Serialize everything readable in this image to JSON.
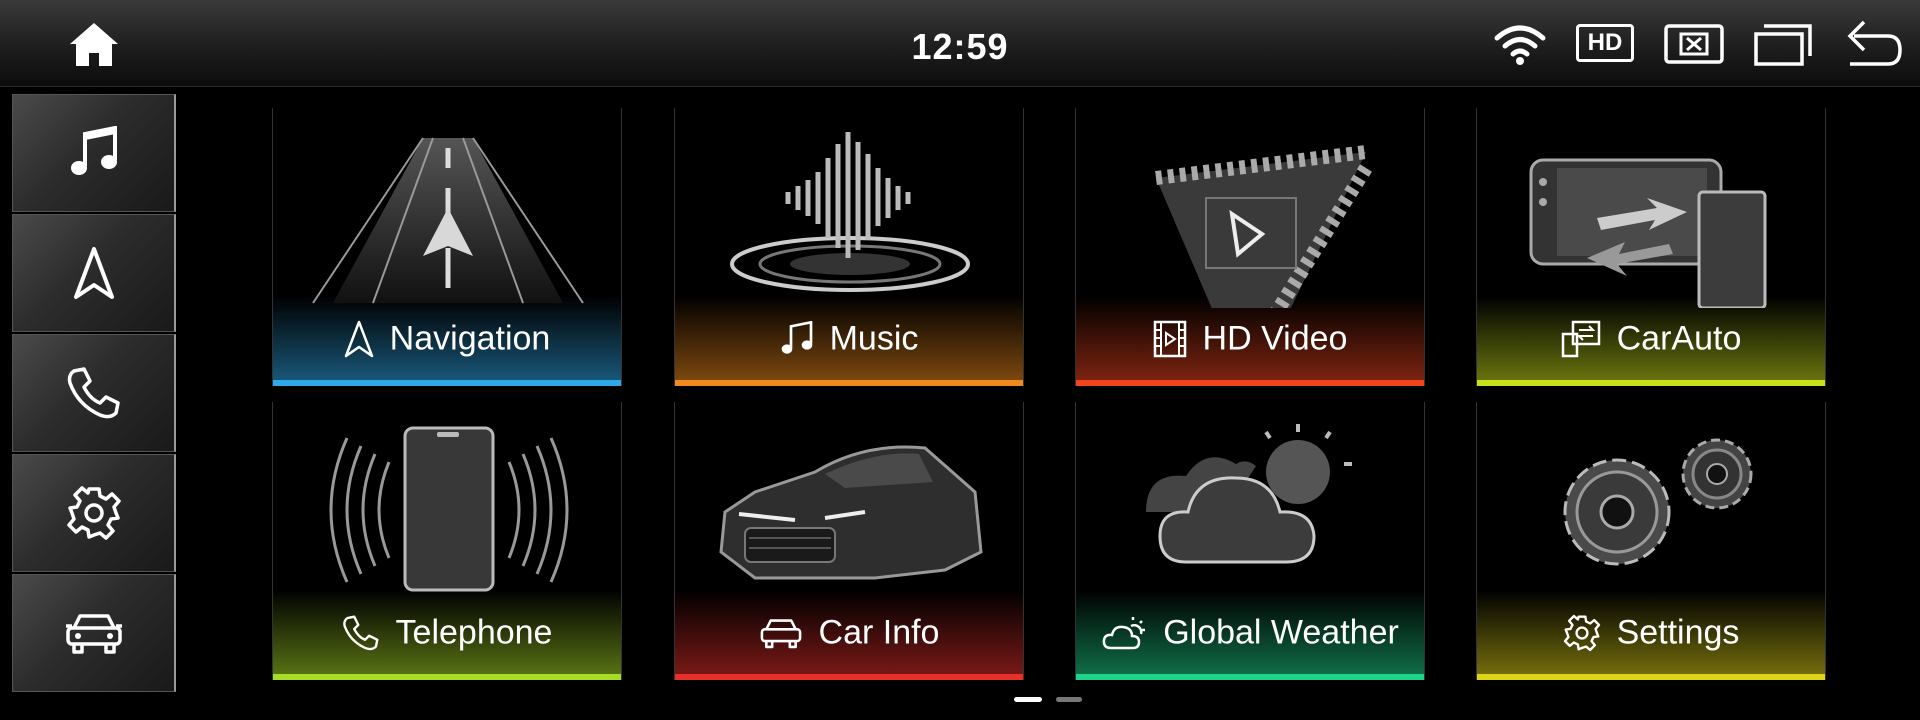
{
  "status_bar": {
    "time": "12:59",
    "hd_label": "HD",
    "icons": [
      "home-icon",
      "wifi-icon",
      "hd-icon",
      "close-app-icon",
      "recent-apps-icon",
      "back-icon"
    ]
  },
  "sidebar": {
    "items": [
      {
        "icon": "music-note-icon"
      },
      {
        "icon": "navigation-arrow-icon"
      },
      {
        "icon": "phone-icon"
      },
      {
        "icon": "gear-icon"
      },
      {
        "icon": "car-icon"
      }
    ]
  },
  "apps": [
    {
      "label": "Navigation",
      "icon": "navigation-arrow-icon",
      "accent": "#2fa8e8"
    },
    {
      "label": "Music",
      "icon": "music-note-icon",
      "accent": "#f08a1c"
    },
    {
      "label": "HD Video",
      "icon": "film-icon",
      "accent": "#f0441e"
    },
    {
      "label": "CarAuto",
      "icon": "phone-link-icon",
      "accent": "#c8e01a"
    },
    {
      "label": "Telephone",
      "icon": "phone-icon",
      "accent": "#a8dc26"
    },
    {
      "label": "Car Info",
      "icon": "car-icon",
      "accent": "#e8302a"
    },
    {
      "label": "Global Weather",
      "icon": "cloud-sun-icon",
      "accent": "#1ed48a"
    },
    {
      "label": "Settings",
      "icon": "gear-icon",
      "accent": "#e0d418"
    }
  ],
  "pager": {
    "pages": 2,
    "current": 1
  }
}
